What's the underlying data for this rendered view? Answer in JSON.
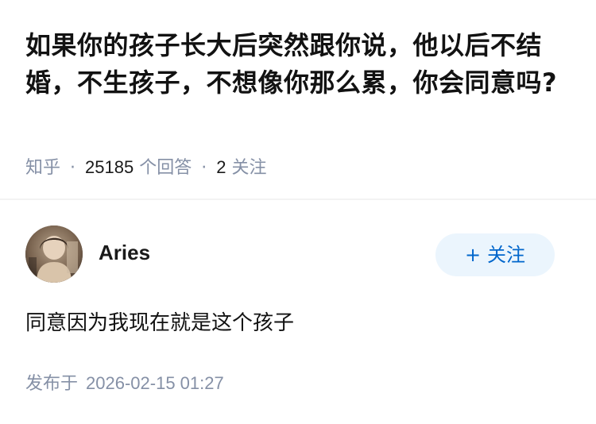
{
  "question": {
    "title": "如果你的孩子长大后突然跟你说，他以后不结婚，不生孩子，不想像你那么累，你会同意吗?"
  },
  "meta": {
    "source": "知乎",
    "answer_count": "25185",
    "answer_unit": "个回答",
    "follower_count": "2",
    "follower_unit": "关注",
    "separator": "·"
  },
  "answer": {
    "author": {
      "name": "Aries",
      "avatar_icon": "user-photo-avatar"
    },
    "follow_button": {
      "plus": "+",
      "label": "关注"
    },
    "content": "同意因为我现在就是这个孩子",
    "publish_label": "发布于",
    "publish_time": "2026-02-15 01:27"
  },
  "colors": {
    "accent": "#0066cc",
    "follow_bg": "#ebf5fd",
    "muted": "#8590a6"
  }
}
